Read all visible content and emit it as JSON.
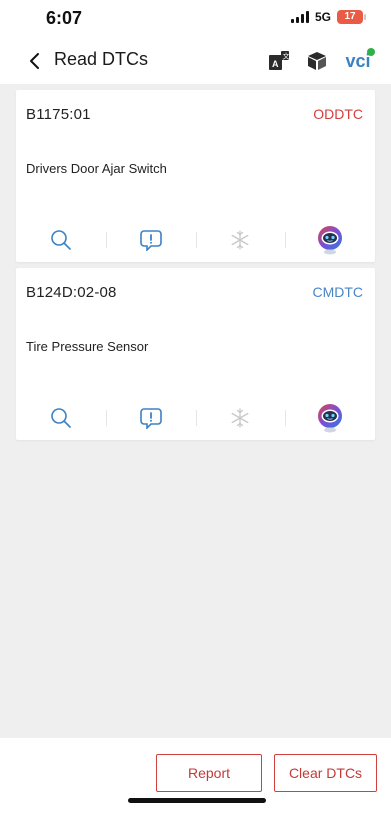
{
  "status_bar": {
    "time": "6:07",
    "network": "5G",
    "battery": "17"
  },
  "header": {
    "title": "Read DTCs",
    "vci_label": "VCI"
  },
  "colors": {
    "accent_blue": "#3b82c4",
    "red": "#d2403d",
    "cmdtc_blue": "#4a86c6"
  },
  "dtcs": [
    {
      "code": "B1175:01",
      "type": "ODDTC",
      "type_color": "#d2403d",
      "description": "Drivers Door Ajar Switch"
    },
    {
      "code": "B124D:02-08",
      "type": "CMDTC",
      "type_color": "#4a86c6",
      "description": "Tire Pressure Sensor"
    }
  ],
  "card_actions": [
    {
      "icon": "search-icon",
      "enabled": true
    },
    {
      "icon": "message-alert-icon",
      "enabled": true
    },
    {
      "icon": "snowflake-icon",
      "enabled": false
    },
    {
      "icon": "robot-assistant-icon",
      "enabled": true
    }
  ],
  "footer": {
    "report_label": "Report",
    "clear_label": "Clear DTCs"
  }
}
